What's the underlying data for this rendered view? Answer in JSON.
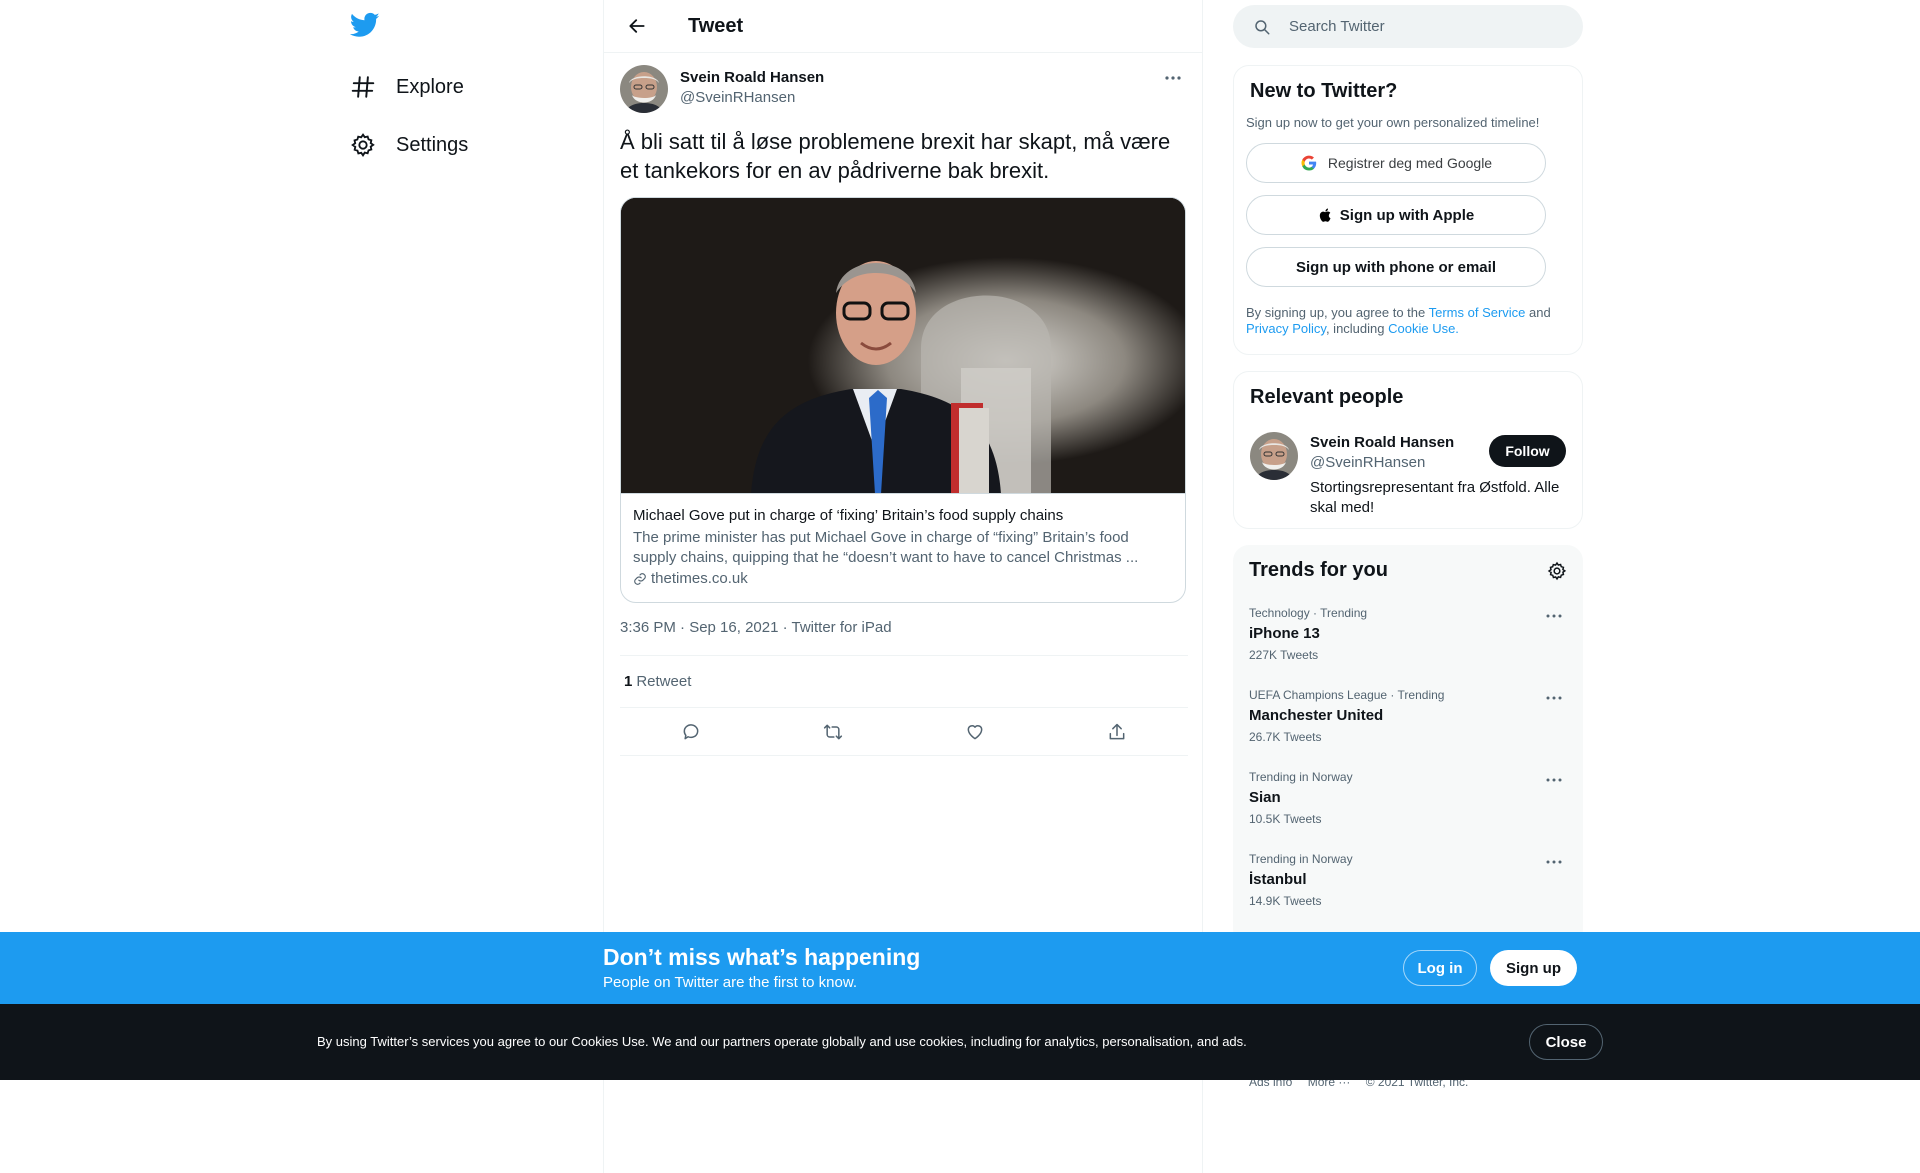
{
  "nav": {
    "logo": "twitter-bird-icon",
    "items": [
      {
        "label": "Explore",
        "icon": "hashtag-icon"
      },
      {
        "label": "Settings",
        "icon": "gear-icon"
      }
    ]
  },
  "header": {
    "title": "Tweet"
  },
  "tweet": {
    "author_name": "Svein Roald Hansen",
    "author_handle": "@SveinRHansen",
    "text": "Å bli satt til å løse problemene brexit har skapt, må være et tankekors for en av pådriverne bak brexit.",
    "card": {
      "title": "Michael Gove put in charge of ‘fixing’ Britain’s food supply chains",
      "description": "The prime minister has put Michael Gove in charge of “fixing” Britain’s food supply chains, quipping that he “doesn’t want to have to cancel Christmas ...",
      "domain": "thetimes.co.uk"
    },
    "timestamp": "3:36 PM · Sep 16, 2021 · Twitter for iPad",
    "retweet_count": "1",
    "retweet_label": "Retweet"
  },
  "search": {
    "placeholder": "Search Twitter"
  },
  "signup": {
    "title": "New to Twitter?",
    "subtitle": "Sign up now to get your own personalized timeline!",
    "google_label": "Registrer deg med Google",
    "apple_label": "Sign up with Apple",
    "phone_label": "Sign up with phone or email",
    "legal_prefix": "By signing up, you agree to the ",
    "terms_link": "Terms of Service",
    "legal_and": " and ",
    "privacy_link": "Privacy Policy",
    "legal_including": ", including ",
    "cookie_link": "Cookie Use."
  },
  "relevant": {
    "title": "Relevant people",
    "name": "Svein Roald Hansen",
    "handle": "@SveinRHansen",
    "bio": "Stortingsrepresentant fra Østfold. Alle skal med!",
    "follow_label": "Follow"
  },
  "trends": {
    "title": "Trends for you",
    "items": [
      {
        "meta": "Technology · Trending",
        "name": "iPhone 13",
        "count": "227K Tweets"
      },
      {
        "meta": "UEFA Champions League · Trending",
        "name": "Manchester United",
        "count": "26.7K Tweets"
      },
      {
        "meta": "Trending in Norway",
        "name": "Sian",
        "count": "10.5K Tweets"
      },
      {
        "meta": "Trending in Norway",
        "name": "İstanbul",
        "count": "14.9K Tweets"
      }
    ]
  },
  "footer": {
    "ads_info": "Ads info",
    "more": "More ···",
    "copyright": "© 2021 Twitter, Inc."
  },
  "login_bar": {
    "headline": "Don’t miss what’s happening",
    "subline": "People on Twitter are the first to know.",
    "login_label": "Log in",
    "signup_label": "Sign up"
  },
  "cookie_bar": {
    "text": "By using Twitter’s services you agree to our Cookies Use. We and our partners operate globally and use cookies, including for analytics, personalisation, and ads.",
    "close_label": "Close"
  },
  "colors": {
    "accent": "#1d9bf0",
    "text": "#0f1419",
    "muted": "#536471",
    "dark_bar": "#0f1419"
  }
}
